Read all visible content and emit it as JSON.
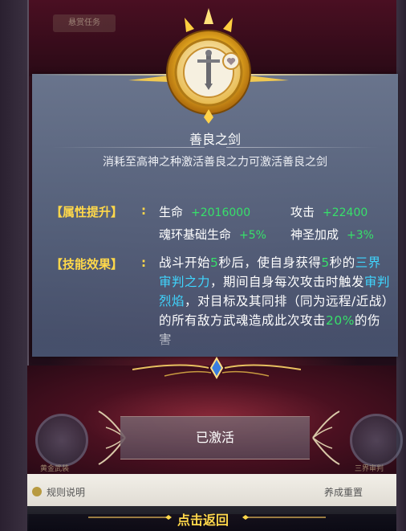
{
  "background": {
    "top_tag": "悬赏任务",
    "left_emblem_label": "黄金武装",
    "right_emblem_label": "三界审判",
    "footer_left": "规则说明",
    "footer_right": "养成重置"
  },
  "relic": {
    "icon": "sword-emblem-icon",
    "name": "善良之剑",
    "description": "消耗至高神之种激活善良之力可激活善良之剑"
  },
  "attributes": {
    "label": "【属性提升】",
    "colon": ":",
    "items": [
      {
        "name": "生命",
        "value": "+2016000"
      },
      {
        "name": "攻击",
        "value": "+22400"
      },
      {
        "name": "魂环基础生命",
        "value": "+5%"
      },
      {
        "name": "神圣加成",
        "value": "+3%"
      }
    ]
  },
  "skill": {
    "label": "【技能效果】",
    "colon": ":",
    "parts": [
      {
        "text": "战斗开始",
        "style": "white"
      },
      {
        "text": "5",
        "style": "green"
      },
      {
        "text": "秒后，使自身获得",
        "style": "white"
      },
      {
        "text": "5",
        "style": "green"
      },
      {
        "text": "秒的",
        "style": "white"
      },
      {
        "text": "三界审判之力",
        "style": "cyan"
      },
      {
        "text": "，期间自身每次攻击时触发",
        "style": "white"
      },
      {
        "text": "审判烈焰",
        "style": "cyan"
      },
      {
        "text": "，对目标及其同排（同为远程/近战）的所有敌方武魂造成此次攻击",
        "style": "white"
      },
      {
        "text": "20%",
        "style": "green"
      },
      {
        "text": "的伤害",
        "style": "white"
      }
    ]
  },
  "activate_button": {
    "label": "已激活"
  },
  "back_button": {
    "label": "点击返回"
  },
  "colors": {
    "gold": "#ffd84a",
    "green": "#37e06a",
    "cyan": "#3fd6ff",
    "panel": "#5f6b88"
  }
}
